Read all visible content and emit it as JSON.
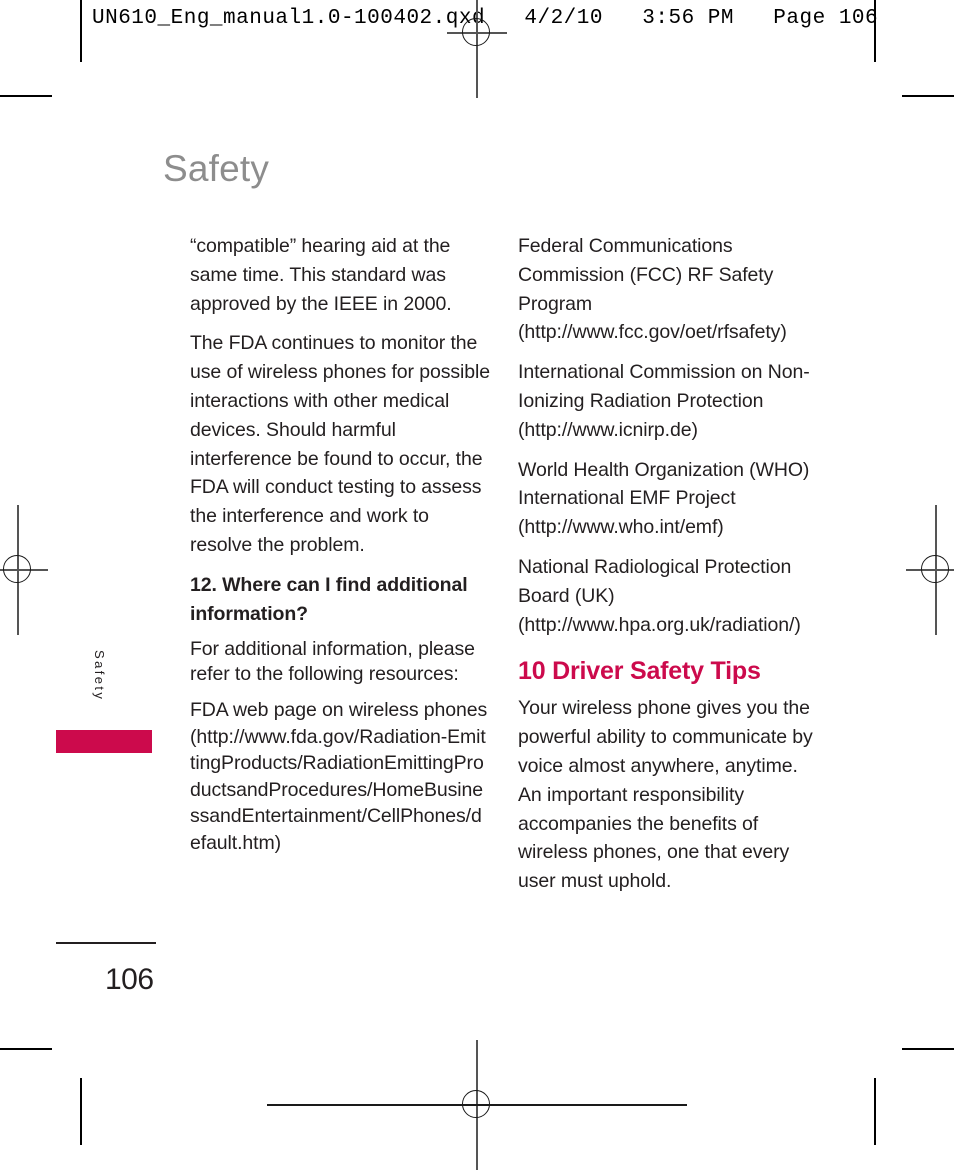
{
  "proof_header": "UN610_Eng_manual1.0-100402.qxd   4/2/10   3:56 PM   Page 106",
  "page": {
    "title": "Safety",
    "side_tab_label": "Safety",
    "folio": "106",
    "accent_color": "#cc0a4c",
    "title_color": "#8d8d8d"
  },
  "columns": {
    "left": {
      "paragraphs": [
        "“compatible” hearing aid at the same time. This standard was approved by the IEEE in 2000.",
        "The FDA continues to monitor the use of wireless phones for possible interactions with other medical devices. Should harmful interference be found to occur, the FDA will conduct testing to assess the interference and work to resolve the problem."
      ],
      "sub_heading": "12. Where can I find additional information?",
      "intro": "For additional information, please refer to the following resources:",
      "resource": "FDA web page on wireless phones (http://www.fda.gov/Radiation-EmittingProducts/RadiationEmittingProductsandProcedures/HomeBusinessandEntertainment/CellPhones/default.htm)"
    },
    "right": {
      "resources": [
        "Federal Communications Commission (FCC) RF Safety Program (http://www.fcc.gov/oet/rfsafety)",
        "International Commission on Non-Ionizing Radiation Protection (http://www.icnirp.de)",
        "World Health Organization (WHO) International EMF Project (http://www.who.int/emf)",
        "National Radiological Protection Board (UK) (http://www.hpa.org.uk/radiation/)"
      ],
      "section_heading": "10 Driver Safety Tips",
      "section_body": "Your wireless phone gives you the powerful ability to communicate by voice almost anywhere, anytime. An important responsibility accompanies the benefits of wireless phones, one that every user must uphold."
    }
  }
}
